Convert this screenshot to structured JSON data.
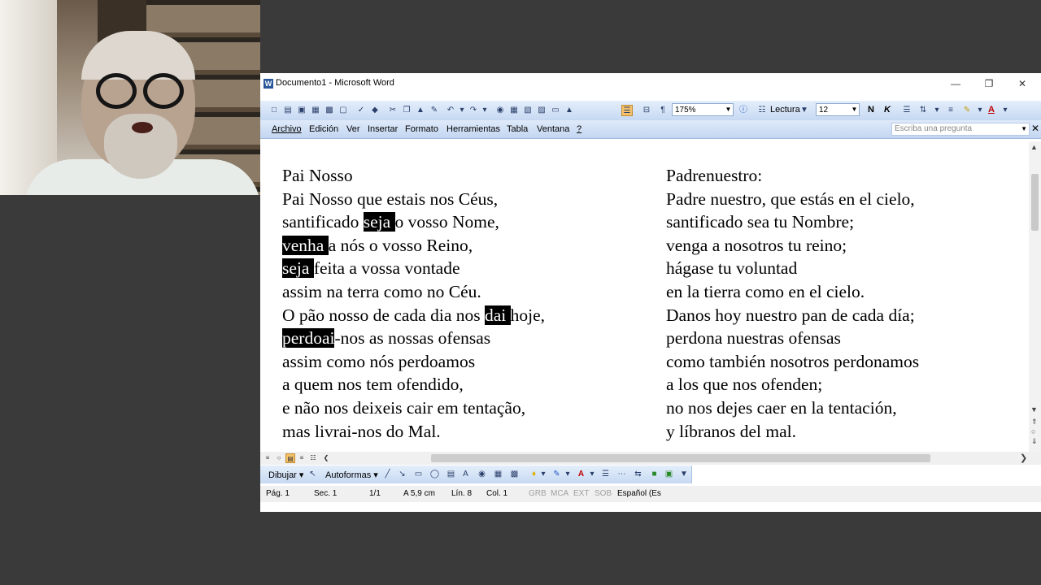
{
  "window": {
    "title": "Documento1 - Microsoft Word"
  },
  "toolbar": {
    "zoom": "175%",
    "reading_label": "Lectura",
    "font_size": "12",
    "bold_label": "N",
    "italic_label": "K",
    "font_color_label": "A"
  },
  "menu": {
    "items": [
      "Archivo",
      "Edición",
      "Ver",
      "Insertar",
      "Formato",
      "Herramientas",
      "Tabla",
      "Ventana",
      "?"
    ],
    "help_placeholder": "Escriba una pregunta"
  },
  "document": {
    "left": [
      "Pai Nosso",
      "Pai Nosso que estais nos Céus,",
      [
        "santificado ",
        "seja ",
        "o vosso Nome,"
      ],
      [
        "",
        "venha ",
        "a nós o vosso Reino,"
      ],
      [
        "",
        "seja ",
        "feita a vossa vontade"
      ],
      "assim na terra como no Céu.",
      [
        "O pão nosso de cada dia nos ",
        "dai ",
        "hoje,"
      ],
      [
        "",
        "perdoai",
        "-nos as nossas ofensas"
      ],
      "assim como nós perdoamos",
      "a quem nos tem ofendido,",
      "e não nos deixeis cair em tentação,",
      "mas livrai-nos do Mal."
    ],
    "right": [
      "Padrenuestro:",
      "Padre nuestro, que estás en el cielo,",
      "santificado sea tu Nombre;",
      "venga a nosotros tu reino;",
      "hágase tu voluntad",
      "en la tierra como en el cielo.",
      "Danos hoy nuestro pan de cada día;",
      "perdona nuestras ofensas",
      "como también nosotros perdonamos",
      "a los que nos ofenden;",
      "no nos dejes caer en la tentación,",
      "y líbranos del mal."
    ]
  },
  "drawing": {
    "draw_label": "Dibujar",
    "autoshapes_label": "Autoformas"
  },
  "status": {
    "page": "Pág. 1",
    "section": "Sec. 1",
    "pages": "1/1",
    "at": "A 5,9 cm",
    "line": "Lín. 8",
    "col": "Col. 1",
    "rec": "GRB",
    "trk": "MCA",
    "ext": "EXT",
    "ovr": "SOB",
    "lang": "Español (Es"
  },
  "colors": {
    "toolbar": "#c6d9f2",
    "highlight": "#000000",
    "background": "#3a3a3a"
  }
}
